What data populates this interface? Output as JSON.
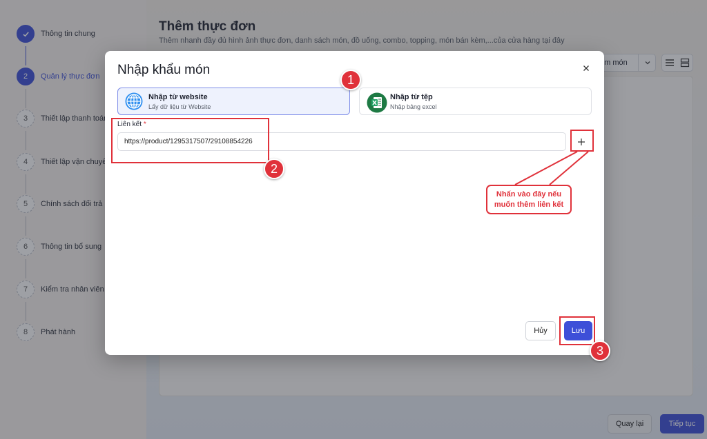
{
  "stepper": {
    "steps": [
      {
        "number": "",
        "label": "Thông tin chung",
        "state": "done"
      },
      {
        "number": "2",
        "label": "Quản lý thực đơn",
        "state": "active"
      },
      {
        "number": "3",
        "label": "Thiết lập thanh toán",
        "state": "pending"
      },
      {
        "number": "4",
        "label": "Thiết lập vận chuyển",
        "state": "pending"
      },
      {
        "number": "5",
        "label": "Chính sách đổi trả",
        "state": "pending"
      },
      {
        "number": "6",
        "label": "Thông tin bổ sung",
        "state": "pending"
      },
      {
        "number": "7",
        "label": "Kiểm tra nhân viên A",
        "state": "pending"
      },
      {
        "number": "8",
        "label": "Phát hành",
        "state": "pending"
      }
    ]
  },
  "page": {
    "title": "Thêm thực đơn",
    "subtitle": "Thêm nhanh đầy đủ hình ảnh thực đơn, danh sách món, đồ uống, combo, topping, món bán kèm,...của cửa hàng tại đây",
    "add_dish_label": "êm món"
  },
  "footer": {
    "back_label": "Quay lại",
    "next_label": "Tiếp tục"
  },
  "modal": {
    "title": "Nhập khẩu món",
    "options": [
      {
        "title": "Nhập từ website",
        "desc": "Lấy dữ liệu từ Website",
        "icon": "globe-icon",
        "selected": true
      },
      {
        "title": "Nhập từ tệp",
        "desc": "Nhập bảng excel",
        "icon": "excel-icon",
        "selected": false
      }
    ],
    "link_label": "Liên kết",
    "required_mark": "*",
    "link_value": "https://product/1295317507/29108854226",
    "cancel_label": "Hủy",
    "save_label": "Lưu"
  },
  "annotations": {
    "markers": [
      "1",
      "2",
      "3"
    ],
    "callout_line1": "Nhấn vào đây nếu",
    "callout_line2": "muốn thêm liên kết"
  },
  "colors": {
    "primary": "#3d4fd8",
    "annotation": "#e0313a",
    "selected_card_bg": "#eef2fd"
  }
}
